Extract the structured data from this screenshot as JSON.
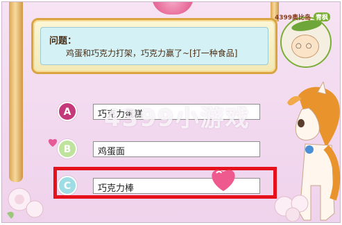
{
  "question": {
    "label": "问题：",
    "text": "鸡蛋和巧克力打架，巧克力赢了~[打一种食品]"
  },
  "logo": {
    "text_top": "4399奥比岛",
    "tag": "青枫"
  },
  "watermark": "4399小游戏",
  "options": [
    {
      "letter": "A",
      "text": "巧克力蛋糕",
      "color": "#c4397a"
    },
    {
      "letter": "B",
      "text": "鸡蛋面",
      "color": "#bfe39d"
    },
    {
      "letter": "C",
      "text": "巧克力棒",
      "color": "#9fdde4"
    }
  ],
  "selected_option": "C",
  "colors": {
    "selection": "#e5121b",
    "frame_gold": "#d9a441",
    "question_bg": "#d4f1f6",
    "background": "#f2d9ef"
  },
  "icons": [
    "heart-icon",
    "pony-mascot",
    "logo-badge",
    "rose-flowers"
  ]
}
